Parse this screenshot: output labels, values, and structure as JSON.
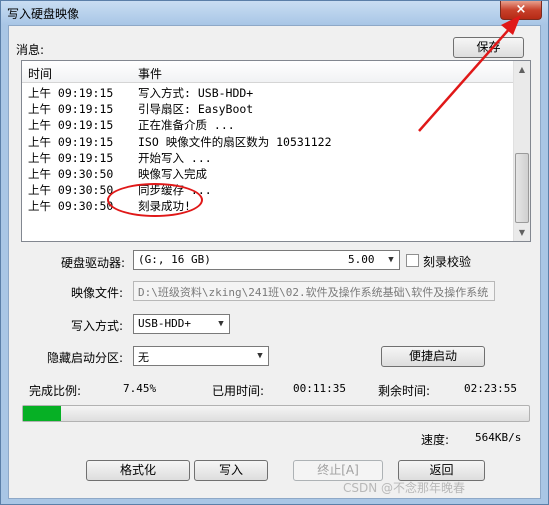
{
  "window": {
    "title": "写入硬盘映像",
    "close_label": "×"
  },
  "messages": {
    "label": "消息:",
    "save_label": "保存",
    "columns": {
      "time": "时间",
      "event": "事件"
    },
    "rows": [
      {
        "time": "上午 09:19:15",
        "event": "写入方式: USB-HDD+"
      },
      {
        "time": "上午 09:19:15",
        "event": "引导扇区: EasyBoot"
      },
      {
        "time": "上午 09:19:15",
        "event": "正在准备介质 ..."
      },
      {
        "time": "上午 09:19:15",
        "event": "ISO 映像文件的扇区数为 10531122"
      },
      {
        "time": "上午 09:19:15",
        "event": "开始写入 ..."
      },
      {
        "time": "上午 09:30:50",
        "event": "映像写入完成"
      },
      {
        "time": "上午 09:30:50",
        "event": "同步缓存 ..."
      },
      {
        "time": "上午 09:30:50",
        "event": "刻录成功!"
      }
    ]
  },
  "drive": {
    "label": "硬盘驱动器:",
    "value": "(G:, 16 GB)",
    "size": "5.00",
    "verify_label": "刻录校验"
  },
  "image_file": {
    "label": "映像文件:",
    "value": "D:\\班级资料\\zking\\241班\\02.软件及操作系统基础\\软件及操作系统"
  },
  "write_mode": {
    "label": "写入方式:",
    "value": "USB-HDD+"
  },
  "hidden_partition": {
    "label": "隐藏启动分区:",
    "value": "无",
    "quick_boot_label": "便捷启动"
  },
  "progress": {
    "done_label": "完成比例:",
    "done_value": "7.45%",
    "done_fraction": 0.0745,
    "elapsed_label": "已用时间:",
    "elapsed_value": "00:11:35",
    "remaining_label": "剩余时间:",
    "remaining_value": "02:23:55",
    "speed_label": "速度:",
    "speed_value": "564KB/s"
  },
  "buttons": {
    "format": "格式化",
    "write": "写入",
    "stop": "终止[A]",
    "back": "返回"
  },
  "watermark": "CSDN @不念那年晚春",
  "colors": {
    "annotation": "#e01818",
    "progress_fill": "#06b025"
  }
}
